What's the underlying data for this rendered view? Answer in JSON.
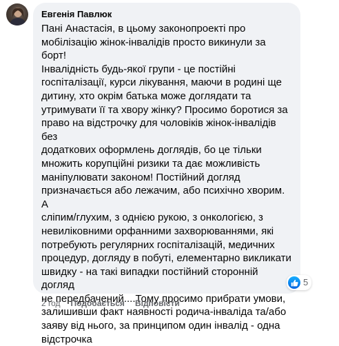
{
  "comment": {
    "author": "Евгенія Павлюк",
    "text": "Пані Анастасія, в цьому законопроекті про\nмобілізацію жінок-інвалідів просто викинули за борт!\nІнвалідність будь-якої групи - це постійні\nгоспіталізації, курси лікування, маючи в родині ще\nдитину, хто окрім батька може доглядати та\nутримувати її та хвору жінку? Просимо боротися за\nправо на відстрочку для чоловіків жінок-інвалідів без\nдодаткових оформлень доглядів, бо це тільки\nмножить корупційні ризики та дає можливість\nманіпулювати законом! Постійний догляд\nпризначається або лежачим, або психічно хворим. А\nсліпим/глухим, з однією рукою, з онкологією, з\nневиліковними орфанними захворюваннями, які\nпотребують регулярних госпіталізацій, медичних\nпроцедур, догляду в побуті, елементарно викликати\nшвидку - на такі випадки постійний сторонній догляд\nне передбачений....Тому просимо прибрати умови,\nзалишивши факт наявності родича-інваліда та/або\nзаяву від нього, за принципом один інвалід - одна\nвідстрочка"
  },
  "actions": {
    "time": "2 год",
    "like": "Подобається",
    "reply": "Відповісти"
  },
  "reactions": {
    "icon": "like-thumb-icon",
    "count": "5"
  },
  "colors": {
    "bubble": "#f0f2f5",
    "meta_text": "#65676b",
    "like_blue": "#0866ff"
  }
}
